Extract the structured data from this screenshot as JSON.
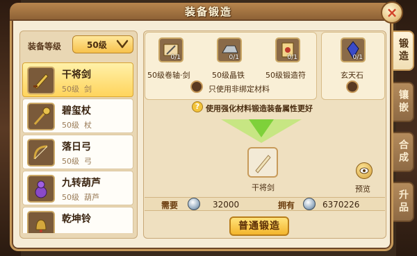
{
  "window": {
    "title": "装备锻造",
    "close_icon": "×"
  },
  "filter": {
    "label": "装备等级",
    "selected_level": "50级"
  },
  "equipment_list": [
    {
      "name": "干将剑",
      "level": "50级",
      "type": "剑",
      "selected": true
    },
    {
      "name": "碧玺杖",
      "level": "50级",
      "type": "杖",
      "selected": false
    },
    {
      "name": "落日弓",
      "level": "50级",
      "type": "弓",
      "selected": false
    },
    {
      "name": "九转葫芦",
      "level": "50级",
      "type": "葫芦",
      "selected": false
    },
    {
      "name": "乾坤铃",
      "level": "",
      "type": "",
      "selected": false
    }
  ],
  "materials": [
    {
      "name": "50级卷轴·剑",
      "count": "0/1"
    },
    {
      "name": "50级晶铁",
      "count": "0/1"
    },
    {
      "name": "50级锻造符",
      "count": "0/1"
    },
    {
      "name": "玄天石",
      "count": "0/1"
    }
  ],
  "unbound_notice": "只使用非绑定材料",
  "hint": "使用强化材料锻造装备属性更好",
  "result": {
    "name": "干将剑"
  },
  "preview": {
    "label": "预览"
  },
  "cost": {
    "need_label": "需要",
    "need_value": "32000",
    "have_label": "拥有",
    "have_value": "6370226"
  },
  "forge_button": "普通锻造",
  "side_tabs": [
    {
      "label": "锻造",
      "active": true
    },
    {
      "label": "镶嵌",
      "active": false
    },
    {
      "label": "合成",
      "active": false
    },
    {
      "label": "升品",
      "active": false
    }
  ]
}
